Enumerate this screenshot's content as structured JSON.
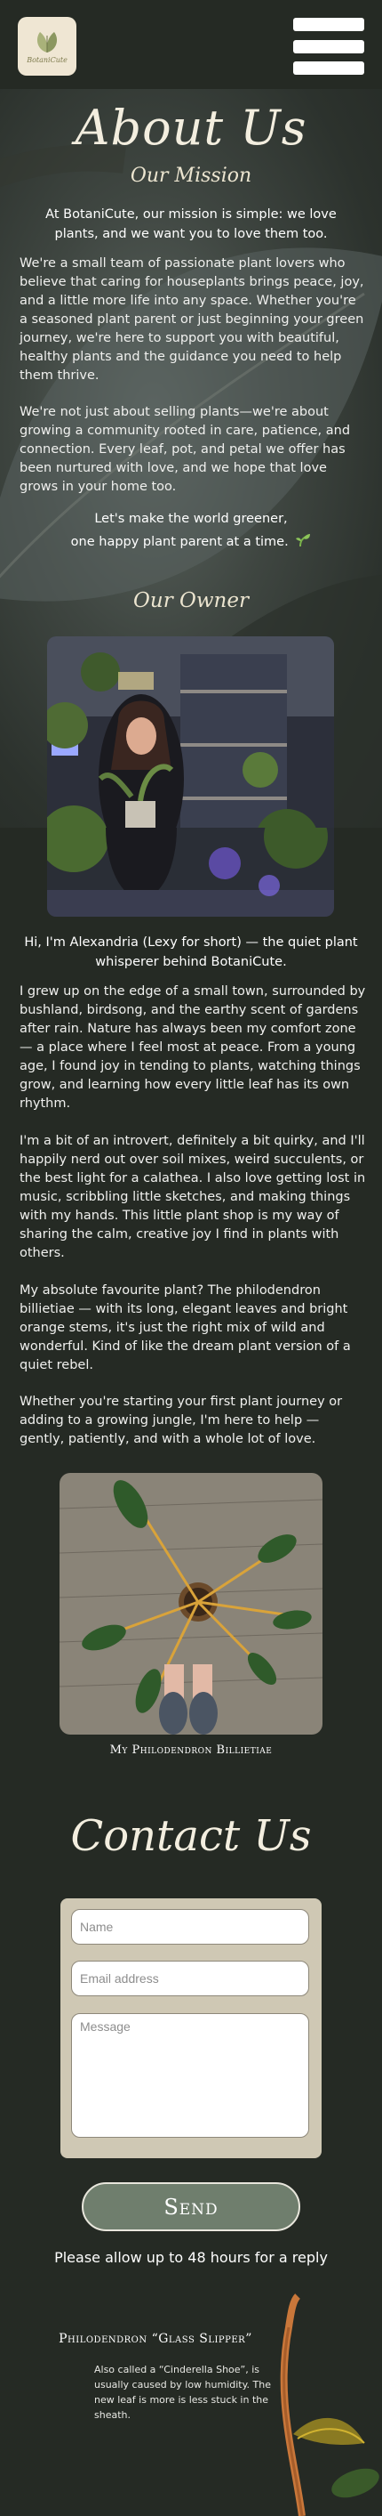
{
  "header": {
    "logo_text": "BotaniCute",
    "menu_icon": "hamburger-icon"
  },
  "about": {
    "title": "About Us",
    "mission_heading": "Our Mission",
    "lead": "At BotaniCute, our mission is simple: we love plants, and we want you to love them too.",
    "paragraphs": [
      "We're a small team of passionate plant lovers who believe that caring for houseplants brings peace, joy, and a little more life into any space. Whether you're a seasoned plant parent or just beginning your green journey, we're here to support you with beautiful, healthy plants and the guidance you need to help them thrive.",
      "We're not just about selling plants—we're about growing a community rooted in care, patience, and connection. Every leaf, pot, and petal we offer has been nurtured with love, and we hope that love grows in your home too."
    ],
    "closing_line1": "Let's make the world greener,",
    "closing_line2": "one happy plant parent at a time.",
    "closing_icon": "seedling-icon"
  },
  "owner": {
    "heading": "Our Owner",
    "caption": "Hi, I'm Alexandria (Lexy for short) — the quiet plant whisperer behind BotaniCute.",
    "bio": [
      "I grew up on the edge of a small town, surrounded by bushland, birdsong, and the earthy scent of gardens after rain. Nature has always been my comfort zone — a place where I feel most at peace. From a young age, I found joy in tending to plants, watching things grow, and learning how every little leaf has its own rhythm.",
      "I'm a bit of an introvert, definitely a bit quirky, and I'll happily nerd out over soil mixes, weird succulents, or the best light for a calathea. I also love getting lost in music, scribbling little sketches, and making things with my hands. This little plant shop is my way of sharing the calm, creative joy I find in plants with others.",
      "My absolute favourite plant? The philodendron billietiae — with its long, elegant leaves and bright orange stems, it's just the right mix of wild and wonderful. Kind of like the dream plant version of a quiet rebel.",
      "Whether you're starting your first plant journey or adding to a growing jungle, I'm here to help — gently, patiently, and with a whole lot of love."
    ],
    "plant_caption": "My Philodendron Billietiae"
  },
  "contact": {
    "title": "Contact Us",
    "name_placeholder": "Name",
    "email_placeholder": "Email address",
    "message_placeholder": "Message",
    "send_label": "Send",
    "note": "Please allow up to 48 hours for a reply"
  },
  "fact": {
    "title": "Philodendron “Glass Slipper”",
    "text": "Also called a “Cinderella Shoe”, is usually caused by low humidity. The new leaf is more is less stuck in the sheath."
  }
}
